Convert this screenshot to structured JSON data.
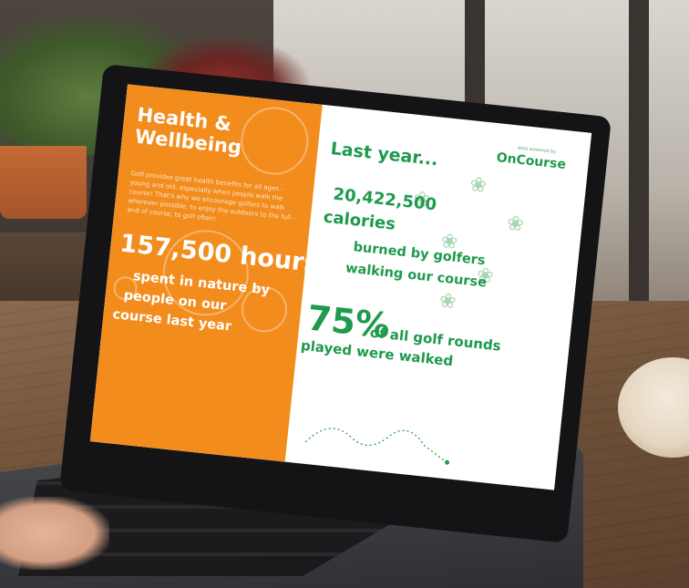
{
  "screen": {
    "left_panel": {
      "title_line1": "Health &",
      "title_line2": "Wellbeing",
      "body": "Golf provides great health benefits for all ages - young and old, especially when people walk the course! That's why we encourage golfers to walk wherever possible, to enjoy the outdoors to the full - and of course, to golf often!",
      "stat_value": "157,500 hours",
      "stat_line1": "spent in nature by",
      "stat_line2": "people on our",
      "stat_line3": "course last year"
    },
    "right_panel": {
      "logo_caption": "data powered by",
      "logo_text": "OnCourse",
      "heading": "Last year...",
      "calories_value": "20,422,500",
      "calories_label": "calories",
      "burned_line1": "burned by golfers",
      "burned_line2": "walking our course",
      "walked_value": "75%",
      "walked_line1": "of all golf rounds",
      "walked_line2": "played were walked"
    },
    "colors": {
      "orange": "#f28c1d",
      "green": "#1e9a4d",
      "light_green": "#a7d8b4"
    },
    "icons": {
      "butterfly": "butterfly-icon",
      "speech_check": "check-bubble-icon"
    }
  }
}
